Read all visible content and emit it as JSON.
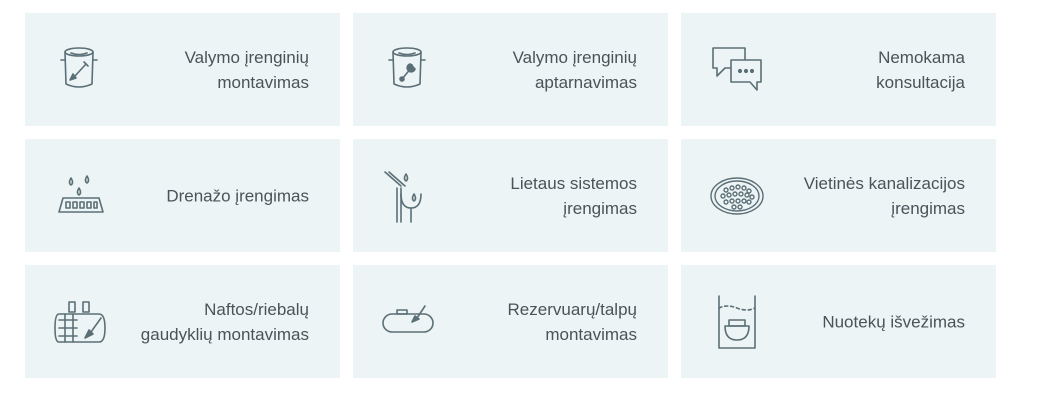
{
  "accent_color": "#5b6f76",
  "card_background": "#ecf4f6",
  "text_color": "#4a5358",
  "services": [
    {
      "icon": "tank-shovel-icon",
      "lines": [
        "Valymo įrenginių",
        "montavimas"
      ]
    },
    {
      "icon": "tank-wrench-icon",
      "lines": [
        "Valymo įrenginių",
        "aptarnavimas"
      ]
    },
    {
      "icon": "chat-bubbles-icon",
      "lines": [
        "Nemokama",
        "konsultacija"
      ]
    },
    {
      "icon": "drainage-icon",
      "lines": [
        "Drenažo įrengimas"
      ]
    },
    {
      "icon": "gutter-icon",
      "lines": [
        "Lietaus sistemos",
        "įrengimas"
      ]
    },
    {
      "icon": "manhole-grate-icon",
      "lines": [
        "Vietinės kanalizacijos",
        "įrengimas"
      ]
    },
    {
      "icon": "separator-tanks-icon",
      "lines": [
        "Naftos/riebalų",
        "gaudyklių montavimas"
      ]
    },
    {
      "icon": "reservoir-shovel-icon",
      "lines": [
        "Rezervuarų/talpų",
        "montavimas"
      ]
    },
    {
      "icon": "sewage-tank-icon",
      "lines": [
        "Nuotekų išvežimas"
      ]
    }
  ]
}
